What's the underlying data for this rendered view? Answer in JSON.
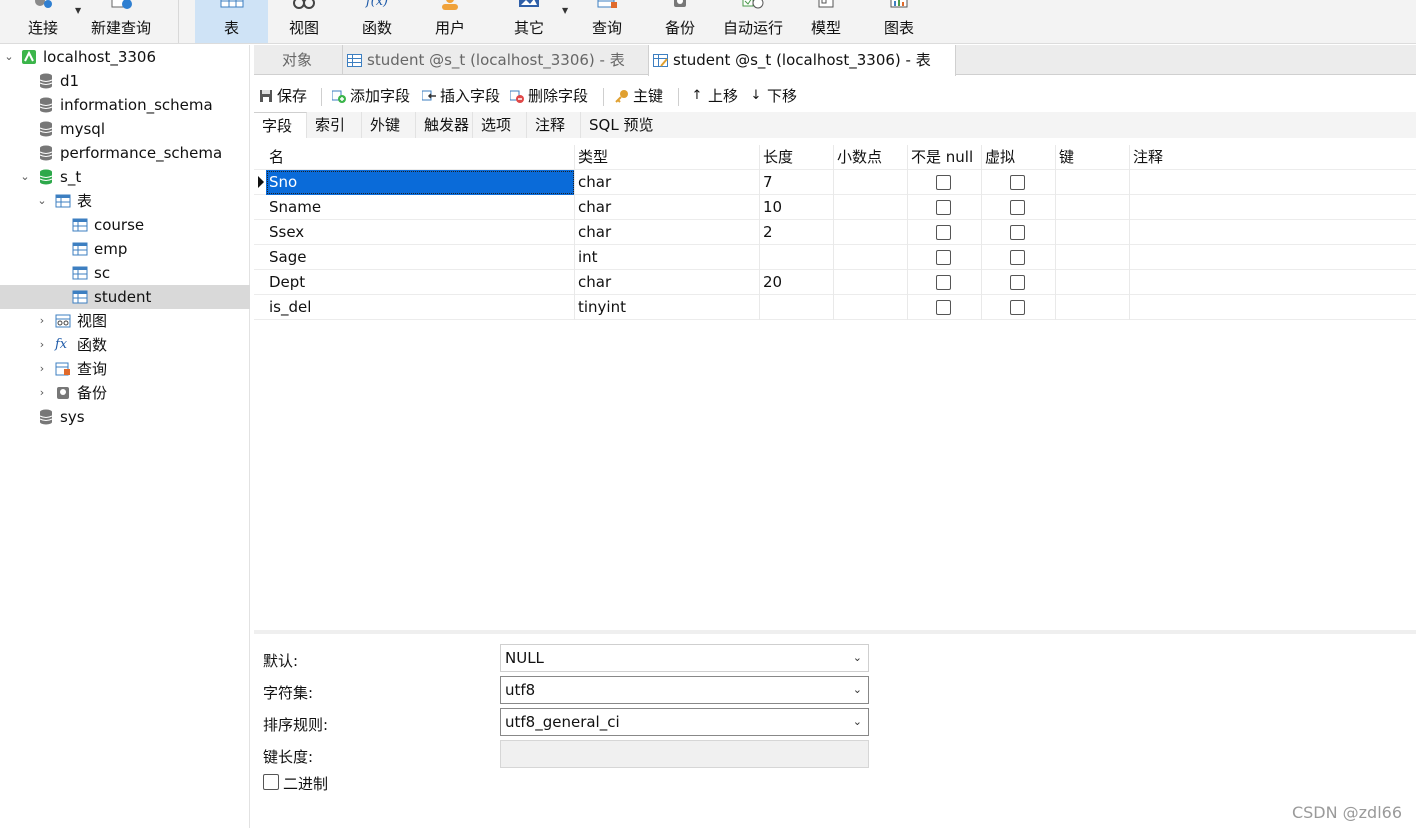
{
  "toolbar": {
    "items": [
      {
        "label": "连接",
        "icon": "connect-icon"
      },
      {
        "label": "新建查询",
        "icon": "new-query-icon"
      },
      {
        "label": "表",
        "icon": "table-icon",
        "active": true
      },
      {
        "label": "视图",
        "icon": "view-icon"
      },
      {
        "label": "函数",
        "icon": "function-icon",
        "icon_text": "f(x)"
      },
      {
        "label": "用户",
        "icon": "user-icon"
      },
      {
        "label": "其它",
        "icon": "other-icon"
      },
      {
        "label": "查询",
        "icon": "query-icon"
      },
      {
        "label": "备份",
        "icon": "backup-icon"
      },
      {
        "label": "自动运行",
        "icon": "autorun-icon"
      },
      {
        "label": "模型",
        "icon": "model-icon"
      },
      {
        "label": "图表",
        "icon": "chart-icon"
      }
    ]
  },
  "tree": {
    "connection": "localhost_3306",
    "databases": [
      "d1",
      "information_schema",
      "mysql",
      "performance_schema",
      "s_t",
      "sys"
    ],
    "open_db": "s_t",
    "tables_folder": "表",
    "tables": [
      "course",
      "emp",
      "sc",
      "student"
    ],
    "selected_table": "student",
    "folders": [
      "视图",
      "函数",
      "查询",
      "备份"
    ]
  },
  "tabs": {
    "objects": "对象",
    "tab1": "student @s_t (localhost_3306) - 表",
    "tab2": "student @s_t (localhost_3306) - 表"
  },
  "field_toolbar": {
    "save": "保存",
    "add_field": "添加字段",
    "insert_field": "插入字段",
    "delete_field": "删除字段",
    "primary_key": "主键",
    "move_up": "上移",
    "move_down": "下移"
  },
  "subtabs": [
    "字段",
    "索引",
    "外键",
    "触发器",
    "选项",
    "注释",
    "SQL 预览"
  ],
  "grid": {
    "columns": [
      "名",
      "类型",
      "长度",
      "小数点",
      "不是 null",
      "虚拟",
      "键",
      "注释"
    ],
    "rows": [
      {
        "name": "Sno",
        "type": "char",
        "length": "7",
        "decimal": "",
        "not_null": false,
        "virtual": false,
        "key": "",
        "comment": "",
        "selected": true
      },
      {
        "name": "Sname",
        "type": "char",
        "length": "10",
        "decimal": "",
        "not_null": false,
        "virtual": false,
        "key": "",
        "comment": ""
      },
      {
        "name": "Ssex",
        "type": "char",
        "length": "2",
        "decimal": "",
        "not_null": false,
        "virtual": false,
        "key": "",
        "comment": ""
      },
      {
        "name": "Sage",
        "type": "int",
        "length": "",
        "decimal": "",
        "not_null": false,
        "virtual": false,
        "key": "",
        "comment": ""
      },
      {
        "name": "Dept",
        "type": "char",
        "length": "20",
        "decimal": "",
        "not_null": false,
        "virtual": false,
        "key": "",
        "comment": ""
      },
      {
        "name": "is_del",
        "type": "tinyint",
        "length": "",
        "decimal": "",
        "not_null": false,
        "virtual": false,
        "key": "",
        "comment": ""
      }
    ]
  },
  "props": {
    "default_label": "默认:",
    "default_value": "NULL",
    "charset_label": "字符集:",
    "charset_value": "utf8",
    "collation_label": "排序规则:",
    "collation_value": "utf8_general_ci",
    "keylen_label": "键长度:",
    "binary_label": "二进制",
    "binary_checked": false
  },
  "watermark": "CSDN @zdl66",
  "colors": {
    "selection": "#0a6bd9",
    "toolbar_active": "#cfe3f6",
    "tree_selected": "#d9d9d9"
  }
}
